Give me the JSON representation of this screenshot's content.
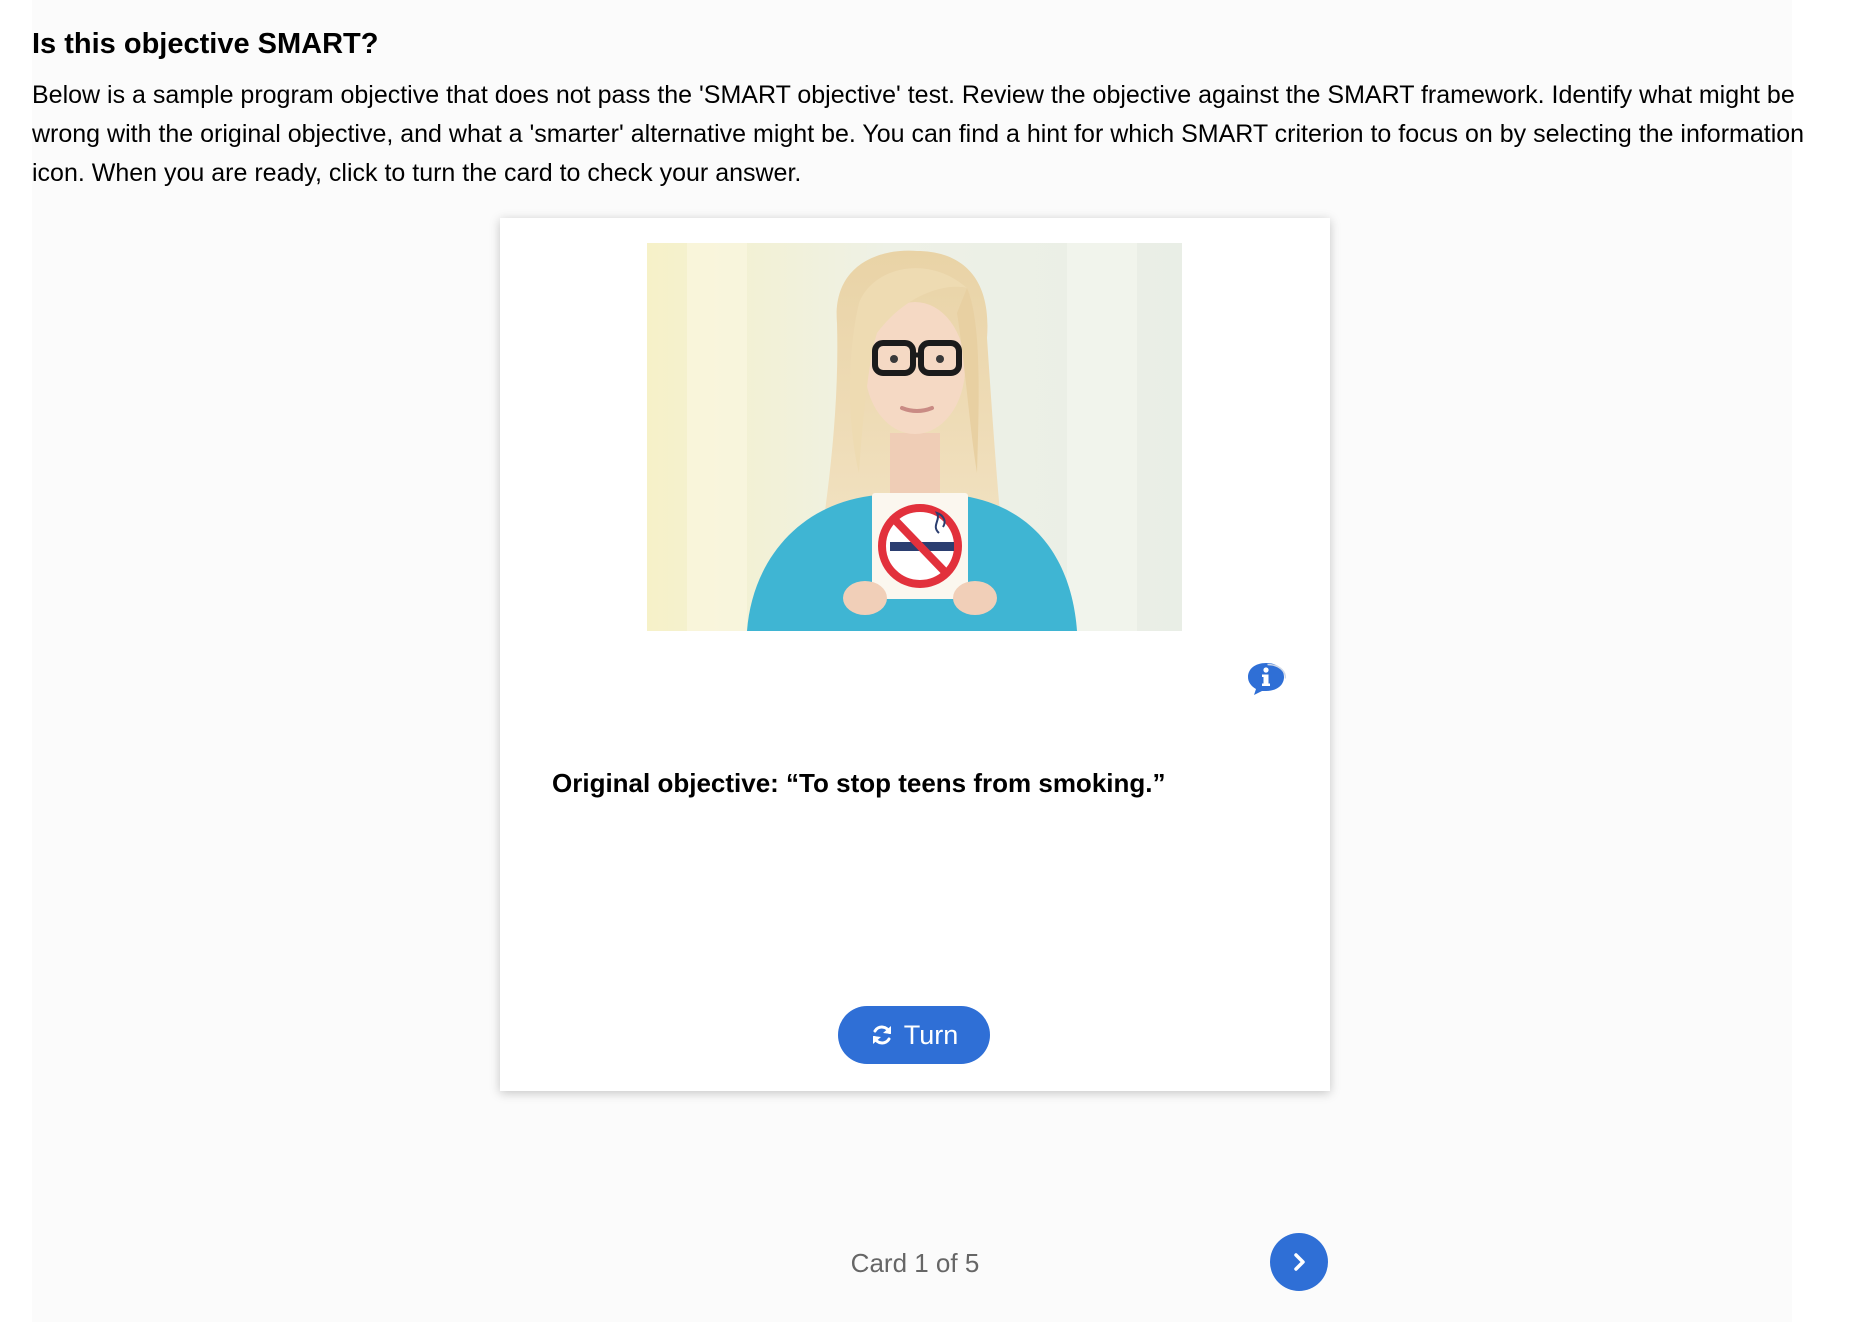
{
  "activity": {
    "title": "Is this objective SMART?",
    "instructions": "Below is a sample program objective that does not pass the 'SMART objective' test. Review the objective against the SMART framework. Identify what might be wrong with the original objective, and what a 'smarter' alternative might be. You can find a hint for which SMART criterion to focus on by selecting the information icon. When you are ready, click to turn the card to check your answer."
  },
  "card": {
    "image_icon": "photo-woman-holding-no-smoking-sign",
    "info_icon": "info-speech-bubble-icon",
    "objective_text": "Original objective:  “To stop teens from smoking.”",
    "turn_icon": "refresh-icon",
    "turn_label": "Turn"
  },
  "pager": {
    "current": 1,
    "total": 5,
    "label": "Card 1 of 5",
    "next_icon": "chevron-right-icon"
  },
  "colors": {
    "accent": "#2f6fd6",
    "panel_background": "#fbfbfb",
    "counter_text": "#666666",
    "no_smoking_red": "#e2313c",
    "shirt": "#3fb5d3"
  }
}
